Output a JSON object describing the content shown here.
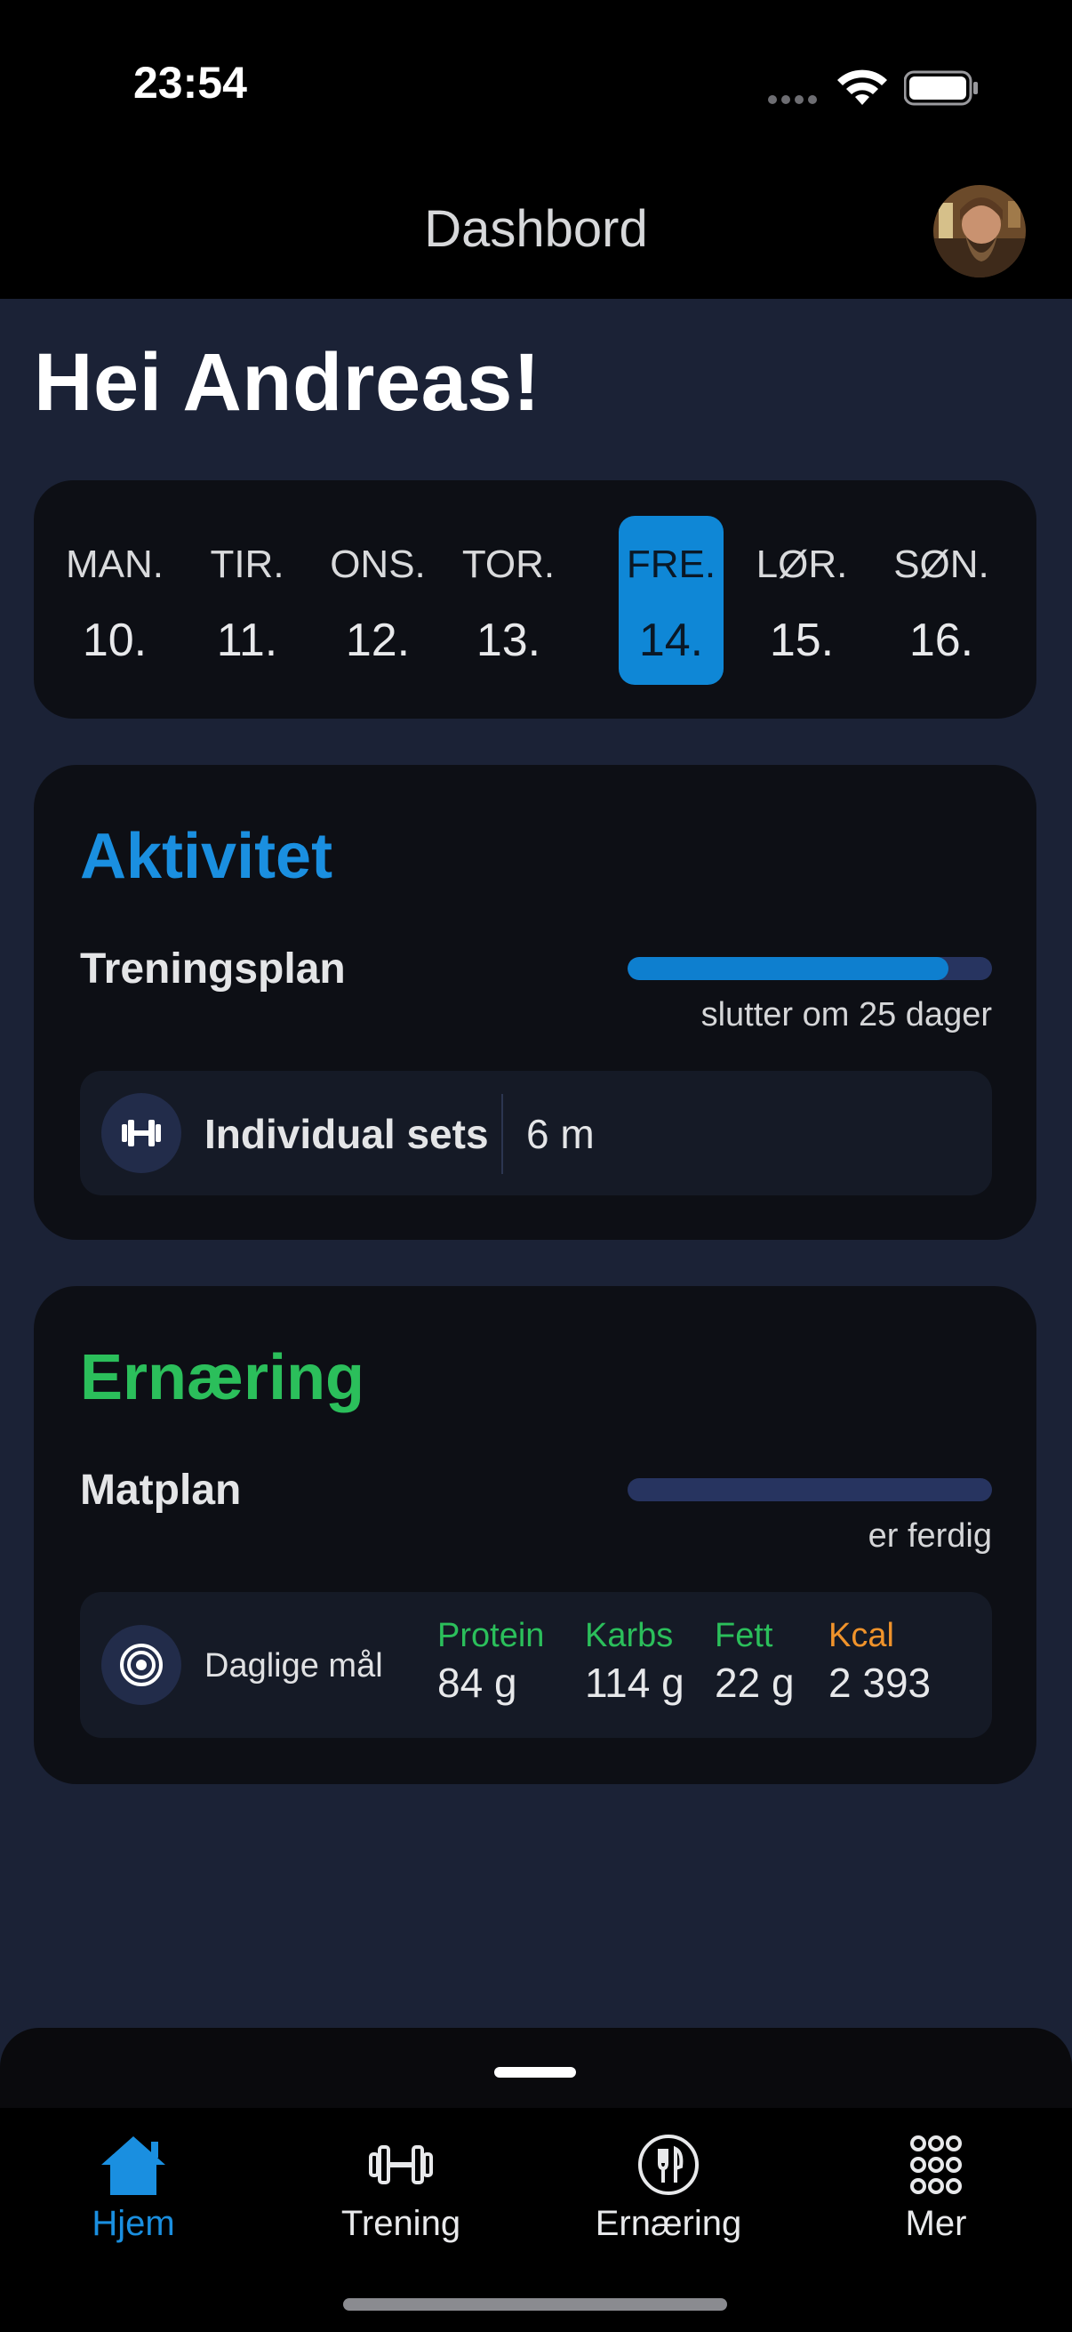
{
  "status": {
    "time": "23:54"
  },
  "nav": {
    "title": "Dashbord"
  },
  "greeting": "Hei Andreas!",
  "week": {
    "days": [
      {
        "name": "MAN.",
        "num": "10."
      },
      {
        "name": "TIR.",
        "num": "11."
      },
      {
        "name": "ONS.",
        "num": "12."
      },
      {
        "name": "TOR.",
        "num": "13."
      },
      {
        "name": "FRE.",
        "num": "14."
      },
      {
        "name": "LØR.",
        "num": "15."
      },
      {
        "name": "SØN.",
        "num": "16."
      }
    ],
    "selected_index": 4
  },
  "activity": {
    "title": "Aktivitet",
    "title_color": "#1a8fe0",
    "plan_label": "Treningsplan",
    "progress_fraction": 0.88,
    "progress_note": "slutter om 25 dager",
    "session": {
      "icon": "dumbbell-icon",
      "label": "Individual sets",
      "duration": "6 m"
    }
  },
  "nutrition": {
    "title": "Ernæring",
    "title_color": "#2bbf5b",
    "plan_label": "Matplan",
    "progress_fraction": 0.0,
    "progress_note": "er ferdig",
    "goals": {
      "icon": "target-icon",
      "label": "Daglige mål",
      "macros": [
        {
          "name": "Protein",
          "value": "84 g",
          "color": "#2bbf5b"
        },
        {
          "name": "Karbs",
          "value": "114 g",
          "color": "#2bbf5b"
        },
        {
          "name": "Fett",
          "value": "22 g",
          "color": "#2bbf5b"
        },
        {
          "name": "Kcal",
          "value": "2 393",
          "color": "#f0932b"
        }
      ]
    }
  },
  "tabbar": {
    "active_color": "#1a8fe0",
    "items": [
      {
        "label": "Hjem",
        "icon": "home-icon",
        "active": true
      },
      {
        "label": "Trening",
        "icon": "dumbbell-icon",
        "active": false
      },
      {
        "label": "Ernæring",
        "icon": "fork-knife-icon",
        "active": false
      },
      {
        "label": "Mer",
        "icon": "grid-icon",
        "active": false
      }
    ]
  }
}
